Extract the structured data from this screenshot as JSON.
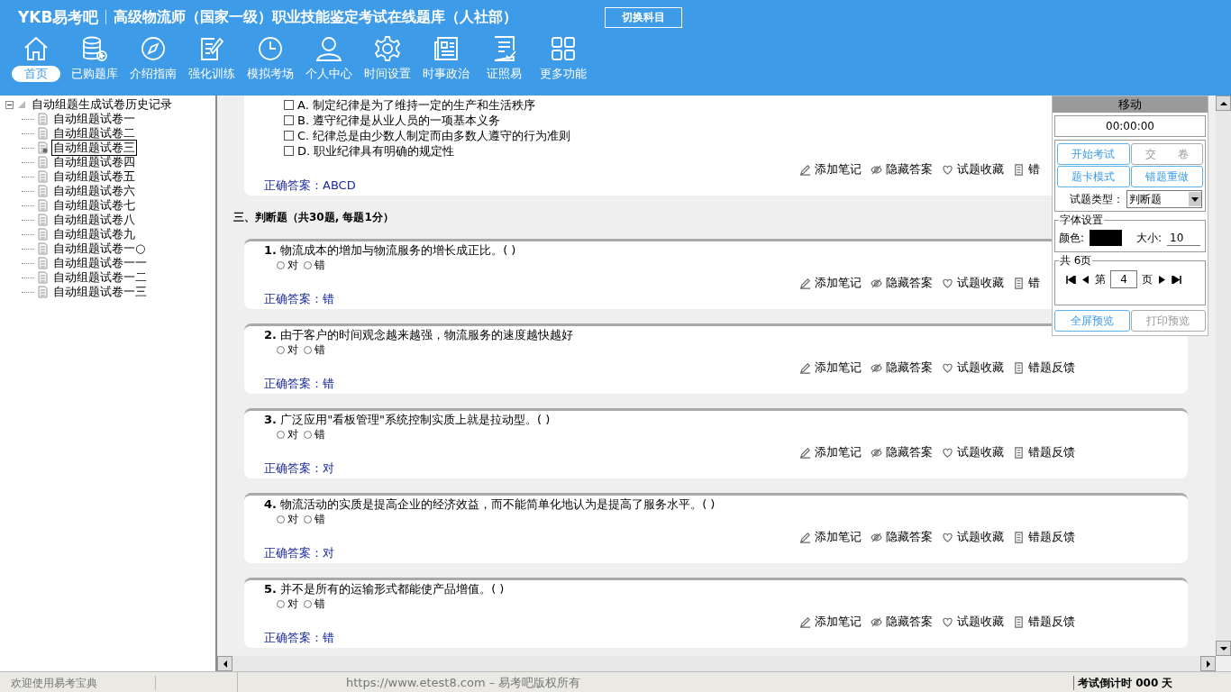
{
  "header": {
    "logo": "YKB易考吧",
    "title": "高级物流师（国家一级）职业技能鉴定考试在线题库（人社部）",
    "switch_button": "切换科目"
  },
  "nav": [
    {
      "label": "首页",
      "selected": true
    },
    {
      "label": "已购题库",
      "selected": false
    },
    {
      "label": "介绍指南",
      "selected": false
    },
    {
      "label": "强化训练",
      "selected": false
    },
    {
      "label": "模拟考场",
      "selected": false
    },
    {
      "label": "个人中心",
      "selected": false
    },
    {
      "label": "时间设置",
      "selected": false
    },
    {
      "label": "时事政治",
      "selected": false
    },
    {
      "label": "证照易",
      "selected": false
    },
    {
      "label": "更多功能",
      "selected": false
    }
  ],
  "tree": {
    "label": "自动组题生成试卷历史记录",
    "expanded": true,
    "children": [
      {
        "label": "自动组题试卷一",
        "selected": false
      },
      {
        "label": "自动组题试卷二",
        "selected": false
      },
      {
        "label": "自动组题试卷三",
        "selected": true
      },
      {
        "label": "自动组题试卷四",
        "selected": false
      },
      {
        "label": "自动组题试卷五",
        "selected": false
      },
      {
        "label": "自动组题试卷六",
        "selected": false
      },
      {
        "label": "自动组题试卷七",
        "selected": false
      },
      {
        "label": "自动组题试卷八",
        "selected": false
      },
      {
        "label": "自动组题试卷九",
        "selected": false
      },
      {
        "label": "自动组题试卷一○",
        "selected": false
      },
      {
        "label": "自动组题试卷一一",
        "selected": false
      },
      {
        "label": "自动组题试卷一二",
        "selected": false
      },
      {
        "label": "自动组题试卷一三",
        "selected": false
      }
    ]
  },
  "previous_question": {
    "options": [
      {
        "label": "A.",
        "text": "制定纪律是为了维持一定的生产和生活秩序",
        "checked": false
      },
      {
        "label": "B.",
        "text": "遵守纪律是从业人员的一项基本义务",
        "checked": false
      },
      {
        "label": "C.",
        "text": "纪律总是由少数人制定而由多数人遵守的行为准则",
        "checked": false
      },
      {
        "label": "D.",
        "text": "职业纪律具有明确的规定性",
        "checked": false
      }
    ],
    "tools": [
      "添加笔记",
      "隐藏答案",
      "试题收藏",
      "错"
    ],
    "answer_label": "正确答案：",
    "answer": "ABCD"
  },
  "section_heading": "三、判断题（共30题, 每题1分）",
  "questions": [
    {
      "number": "1.",
      "text": "物流成本的增加与物流服务的增长成正比。( )",
      "options": [
        {
          "label": "对",
          "selected": false
        },
        {
          "label": "错",
          "selected": false
        }
      ],
      "tools": [
        "添加笔记",
        "隐藏答案",
        "试题收藏",
        "错"
      ],
      "answer_label": "正确答案：",
      "answer": "错"
    },
    {
      "number": "2.",
      "text": "由于客户的时间观念越来越强，物流服务的速度越快越好",
      "options": [
        {
          "label": "对",
          "selected": false
        },
        {
          "label": "错",
          "selected": false
        }
      ],
      "tools": [
        "添加笔记",
        "隐藏答案",
        "试题收藏",
        "错题反馈"
      ],
      "answer_label": "正确答案：",
      "answer": "错"
    },
    {
      "number": "3.",
      "text": "广泛应用\"看板管理\"系统控制实质上就是拉动型。( )",
      "options": [
        {
          "label": "对",
          "selected": false
        },
        {
          "label": "错",
          "selected": false
        }
      ],
      "tools": [
        "添加笔记",
        "隐藏答案",
        "试题收藏",
        "错题反馈"
      ],
      "answer_label": "正确答案：",
      "answer": "对"
    },
    {
      "number": "4.",
      "text": "物流活动的实质是提高企业的经济效益，而不能简单化地认为是提高了服务水平。( )",
      "options": [
        {
          "label": "对",
          "selected": false
        },
        {
          "label": "错",
          "selected": false
        }
      ],
      "tools": [
        "添加笔记",
        "隐藏答案",
        "试题收藏",
        "错题反馈"
      ],
      "answer_label": "正确答案：",
      "answer": "对"
    },
    {
      "number": "5.",
      "text": "并不是所有的运输形式都能使产品增值。( )",
      "options": [
        {
          "label": "对",
          "selected": false
        },
        {
          "label": "错",
          "selected": false
        }
      ],
      "tools": [
        "添加笔记",
        "隐藏答案",
        "试题收藏",
        "错题反馈"
      ],
      "answer_label": "正确答案：",
      "answer": "错"
    }
  ],
  "side_panel": {
    "title": "移动",
    "timer": "00:00:00",
    "buttons": [
      {
        "label": "开始考试",
        "disabled": false
      },
      {
        "label": "交　　卷",
        "disabled": true
      },
      {
        "label": "题卡模式",
        "disabled": false
      },
      {
        "label": "错题重做",
        "disabled": false
      }
    ],
    "type_label": "试题类型：",
    "type_value": "判断题",
    "font_legend": "字体设置",
    "color_label": "颜色:",
    "color": "#000000",
    "size_label": "大小:",
    "size": "10",
    "pages_legend": "共 6页",
    "page_prefix": "第",
    "page": "4",
    "page_suffix": "页",
    "bottom_buttons": [
      {
        "label": "全屏预览",
        "disabled": false
      },
      {
        "label": "打印预览",
        "disabled": true
      }
    ]
  },
  "status_bar": {
    "welcome": "欢迎使用易考宝典",
    "copyright": "https://www.etest8.com – 易考吧版权所有",
    "countdown": "考试倒计时 000 天"
  }
}
